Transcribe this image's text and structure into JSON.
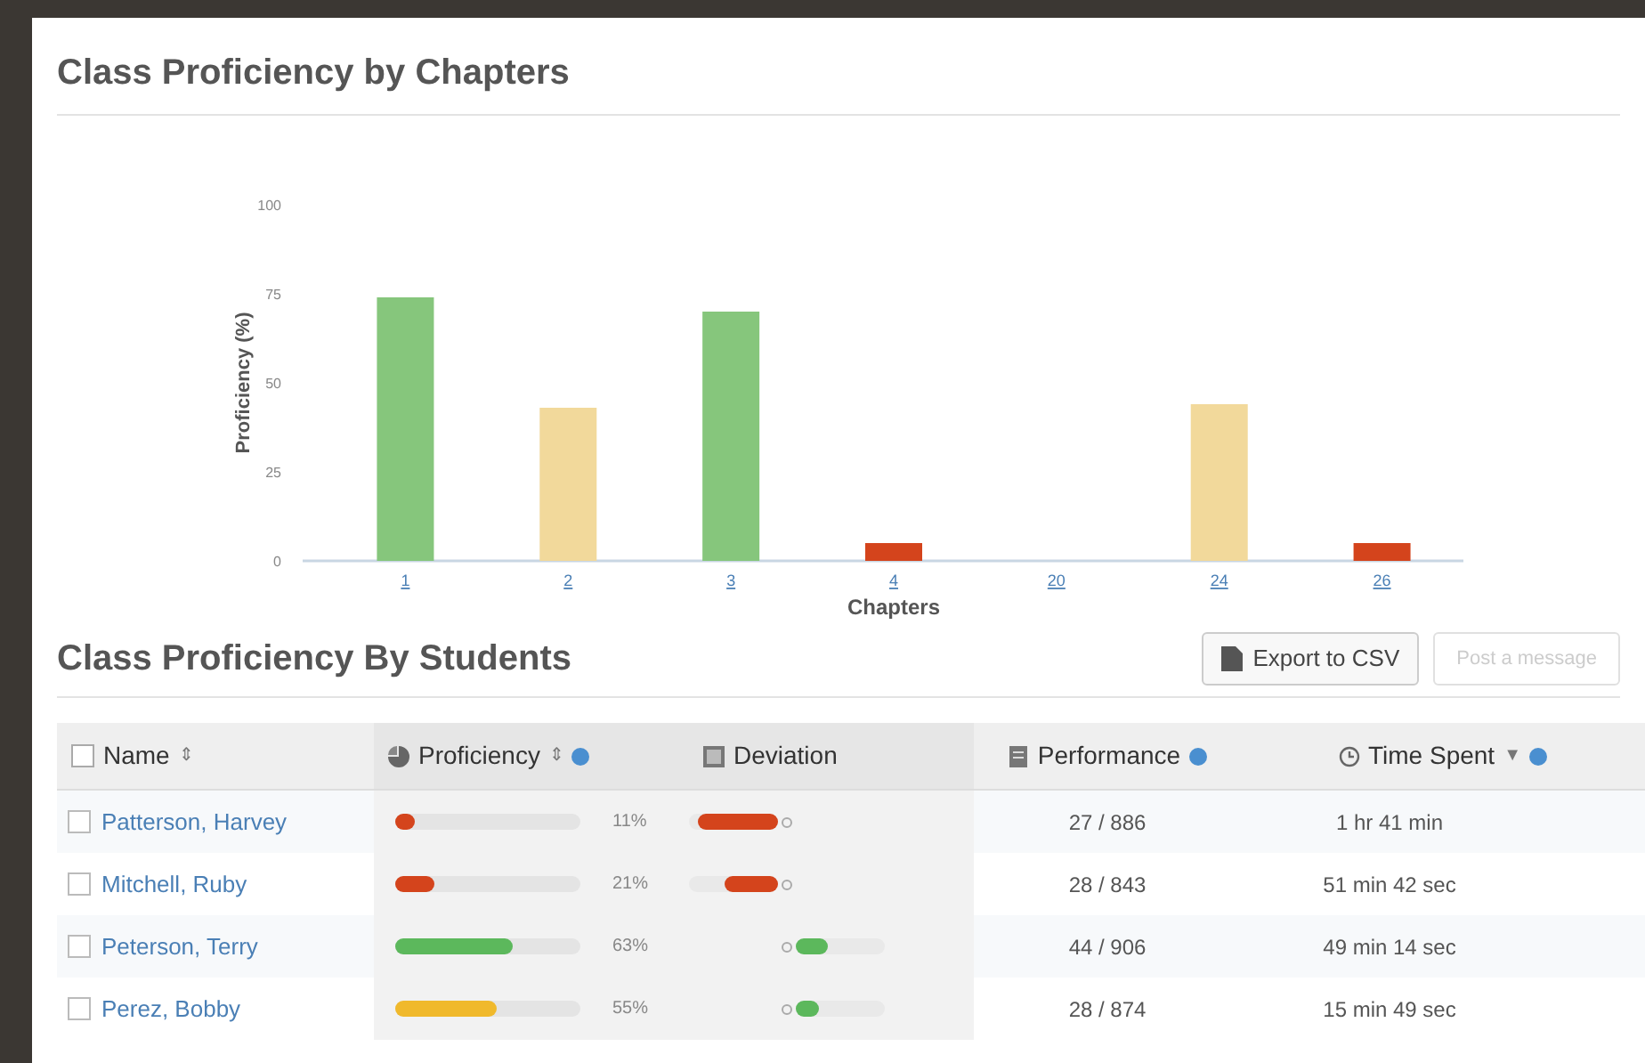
{
  "chapters_section": {
    "title": "Class Proficiency by Chapters",
    "chart_data": {
      "type": "bar",
      "xlabel": "Chapters",
      "ylabel": "Proficiency (%)",
      "categories": [
        "1",
        "2",
        "3",
        "4",
        "20",
        "24",
        "26"
      ],
      "ylim": [
        0,
        100
      ],
      "yticks": [
        0,
        25,
        50,
        75,
        100
      ],
      "series": [
        {
          "color": "#86c67c",
          "values": [
            74,
            null,
            70,
            null,
            null,
            null,
            null
          ]
        },
        {
          "color": "#f2d99b",
          "values": [
            null,
            43,
            null,
            null,
            null,
            44,
            null
          ]
        },
        {
          "color": "#d4441c",
          "values": [
            null,
            null,
            null,
            5,
            0,
            null,
            5
          ]
        }
      ]
    }
  },
  "students_section": {
    "title": "Class Proficiency By Students",
    "buttons": [
      {
        "label": "Export to CSV",
        "disabled": false
      },
      {
        "label": "Post a message",
        "disabled": true
      }
    ],
    "table": {
      "select_all_checked": false,
      "columns": [
        {
          "label": "Name",
          "sort_icon": "⇕",
          "help": false
        },
        {
          "label": "Proficiency",
          "sort_icon": "⇕",
          "help": true
        },
        {
          "label": "Deviation",
          "help": false
        },
        {
          "label": "Performance",
          "help": true
        },
        {
          "label": "Time Spent",
          "sort_icon": "▼",
          "help": true
        }
      ],
      "rows": [
        {
          "name": "Patterson, Harvey",
          "checked": false,
          "proficiency": {
            "level": 0.11,
            "color": "#d4441c",
            "reading": "11%"
          },
          "deviation": {
            "negative": true,
            "level": 0.9,
            "color": "#d4441c"
          },
          "performance": "27 / 886",
          "time": "1 hr 41 min"
        },
        {
          "name": "Mitchell, Ruby",
          "checked": false,
          "proficiency": {
            "level": 0.21,
            "color": "#d4441c",
            "reading": "21%"
          },
          "deviation": {
            "negative": true,
            "level": 0.6,
            "color": "#d4441c"
          },
          "performance": "28 / 843",
          "time": "51 min 42 sec"
        },
        {
          "name": "Peterson, Terry",
          "checked": false,
          "proficiency": {
            "level": 0.63,
            "color": "#5cb85c",
            "reading": "63%"
          },
          "deviation": {
            "negative": false,
            "level": 0.35,
            "color": "#5cb85c"
          },
          "performance": "44 / 906",
          "time": "49 min 14 sec"
        },
        {
          "name": "Perez, Bobby",
          "checked": false,
          "proficiency": {
            "level": 0.55,
            "color": "#f0b92c",
            "reading": "55%"
          },
          "deviation": {
            "negative": false,
            "level": 0.25,
            "color": "#5cb85c"
          },
          "performance": "28 / 874",
          "time": "15 min 49 sec"
        }
      ]
    }
  }
}
